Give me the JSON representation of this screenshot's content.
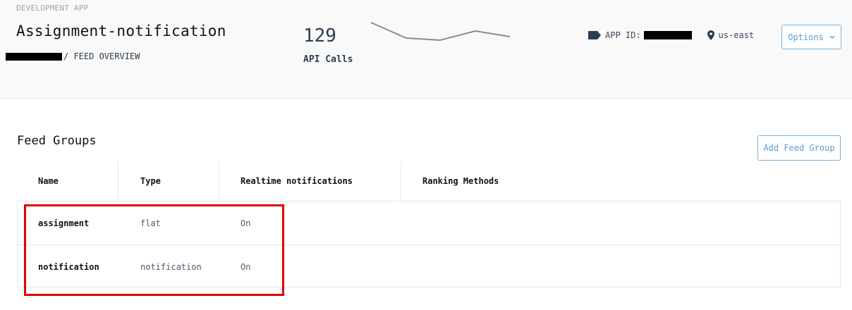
{
  "header": {
    "env_label": "DEVELOPMENT APP",
    "app_title": "Assignment-notification",
    "breadcrumb_current": "/ FEED OVERVIEW",
    "stat": {
      "value": "129",
      "label": "API Calls"
    },
    "app_id_label": "APP ID:",
    "region": "us-east",
    "options_label": "Options",
    "icons": {
      "app_id": "tag-icon",
      "region": "map-pin-icon",
      "options": "chevron-down-icon"
    }
  },
  "feed_groups": {
    "title": "Feed Groups",
    "add_button": "Add Feed Group",
    "columns": [
      "Name",
      "Type",
      "Realtime notifications",
      "Ranking Methods"
    ],
    "rows": [
      {
        "name": "assignment",
        "type": "flat",
        "realtime": "On",
        "ranking": ""
      },
      {
        "name": "notification",
        "type": "notification",
        "realtime": "On",
        "ranking": ""
      }
    ]
  },
  "colors": {
    "accent": "#5b9bd0",
    "highlight": "#e00000",
    "header_bg": "#f9f9f9"
  }
}
